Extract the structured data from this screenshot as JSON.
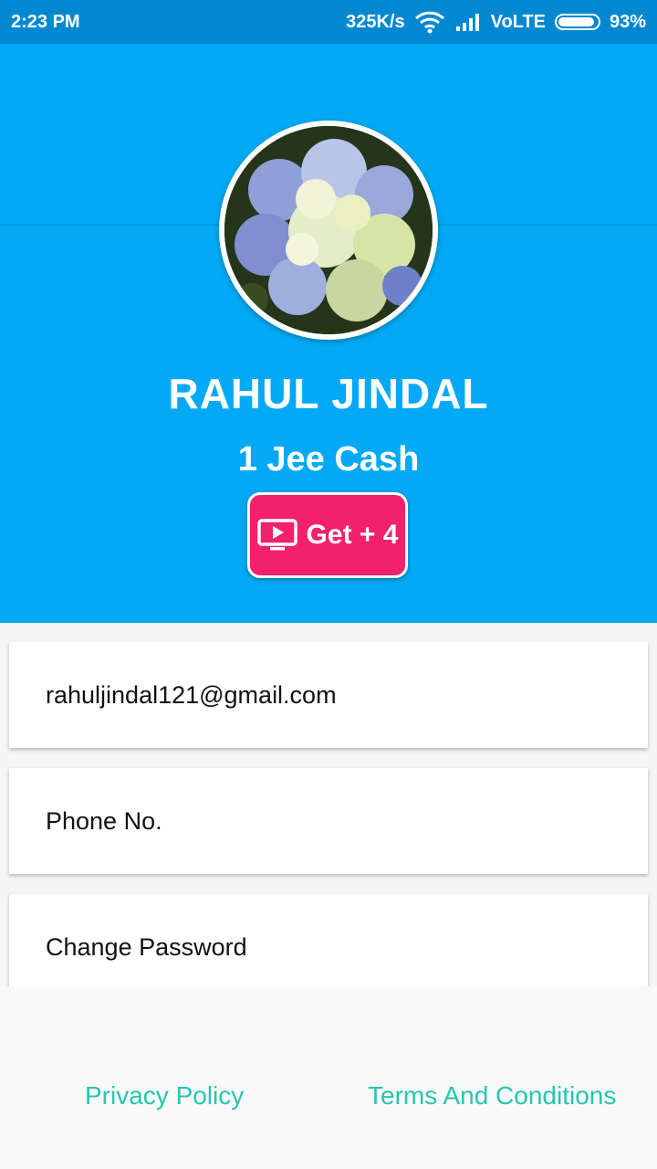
{
  "status_bar": {
    "time": "2:23 PM",
    "speed": "325K/s",
    "network": "VoLTE",
    "battery": "93%",
    "battery_level": 0.93,
    "icons": [
      "wifi-icon",
      "signal-icon",
      "battery-icon"
    ]
  },
  "profile": {
    "name": "RAHUL JINDAL",
    "cash": "1 Jee Cash",
    "avatar": "hydrangea-flower-photo",
    "reward_button": {
      "label": "Get + 4",
      "icon": "video-play-icon"
    }
  },
  "list": {
    "email": "rahuljindal121@gmail.com",
    "phone": "Phone No.",
    "change_password": "Change Password"
  },
  "footer": {
    "privacy": "Privacy Policy",
    "terms": "Terms And Conditions"
  },
  "colors": {
    "header": "#03a9f4",
    "status_bar": "#0288d1",
    "button": "#f2216b",
    "footer_link": "#26c6b0"
  }
}
